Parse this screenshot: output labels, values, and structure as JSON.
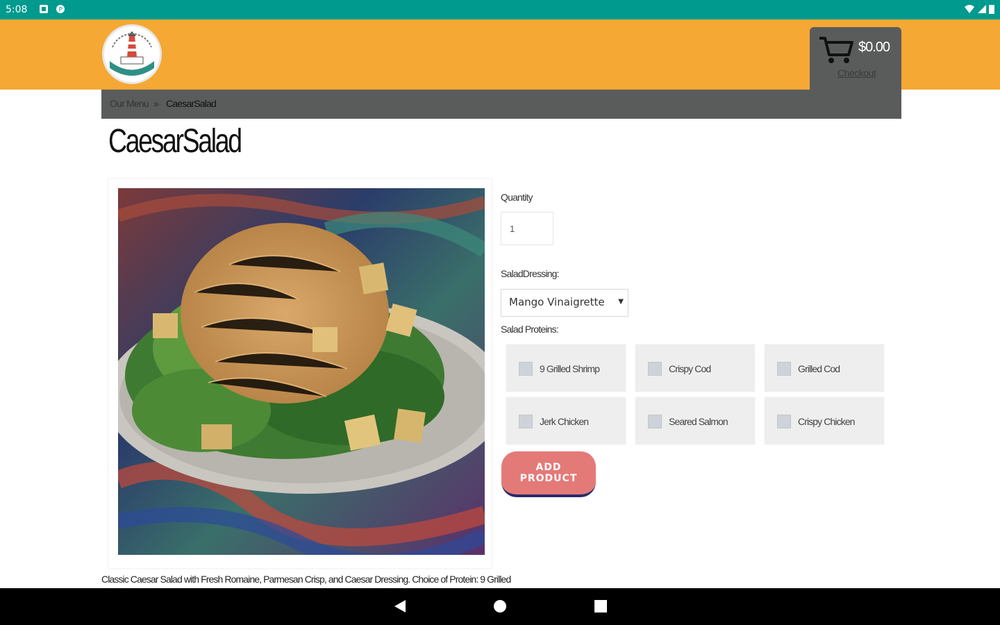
{
  "status_bar": {
    "time": "5:08"
  },
  "header": {
    "cart_total": "$0.00",
    "checkout_label": "Checkout"
  },
  "breadcrumb": {
    "menu_label": "Our Menu",
    "separator": "»",
    "current": "CaesarSalad"
  },
  "product": {
    "title": "CaesarSalad",
    "description": "Classic Caesar Salad with Fresh Romaine, Parmesan Crisp, and Caesar Dressing. Choice of Protein: 9 Grilled"
  },
  "form": {
    "quantity_label": "Quantity",
    "quantity_value": "1",
    "dressing_label": "SaladDressing:",
    "dressing_selected": "Mango Vinaigrette",
    "proteins_label": "Salad Proteins:",
    "proteins": [
      "9 Grilled Shrimp",
      "Crispy Cod",
      "Grilled Cod",
      "Jerk Chicken",
      "Seared Salmon",
      "Crispy Chicken"
    ],
    "add_button": "ADD PRODUCT"
  },
  "colors": {
    "status_bar": "#009a8e",
    "header": "#f5a833",
    "breadcrumb_bar": "#5a5c5c",
    "add_button": "#e47a78"
  }
}
